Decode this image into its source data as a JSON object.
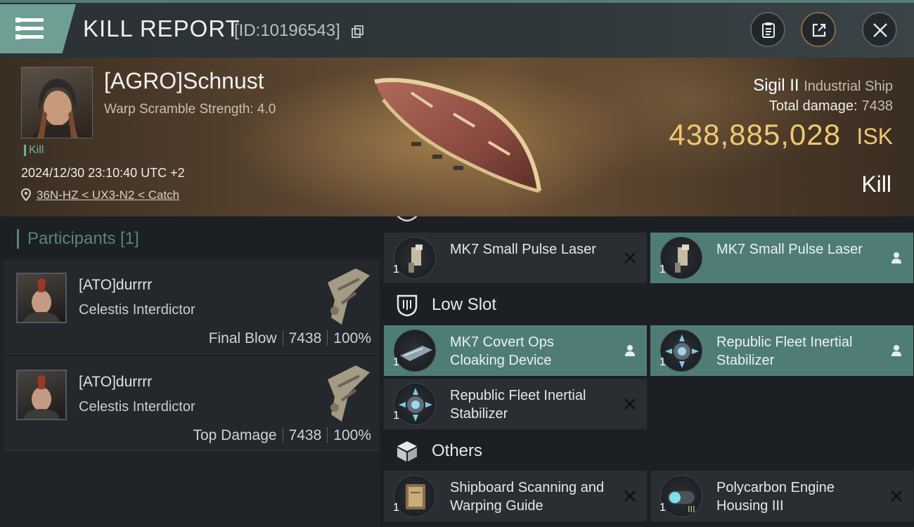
{
  "header": {
    "title": "KILL REPORT",
    "id_text": "[ID:10196543]",
    "buttons": {
      "clipboard": "clipboard-icon",
      "share": "share-icon",
      "close": "close-icon"
    }
  },
  "victim": {
    "pilot_name": "[AGRO]Schnust",
    "warp_scramble": "Warp Scramble Strength: 4.0",
    "kill_tag": "Kill",
    "datetime": "2024/12/30 23:10:40 UTC +2",
    "location": "36N-HZ < UX3-N2 < Catch",
    "ship_name": "Sigil II",
    "ship_class": "Industrial Ship",
    "total_damage_label": "Total damage:",
    "total_damage_value": "7438",
    "isk_value": "438,885,028",
    "isk_label": "ISK",
    "result": "Kill"
  },
  "participants": {
    "title": "Participants [1]",
    "rows": [
      {
        "name": "[ATO]durrrr",
        "ship": "Celestis Interdictor",
        "tag": "Final Blow",
        "damage": "7438",
        "percent": "100%"
      },
      {
        "name": "[ATO]durrrr",
        "ship": "Celestis Interdictor",
        "tag": "Top Damage",
        "damage": "7438",
        "percent": "100%"
      }
    ]
  },
  "fitting": {
    "high_modules": [
      {
        "qty": "1",
        "name": "MK7 Small Pulse Laser",
        "state": "destroyed"
      },
      {
        "qty": "1",
        "name": "MK7 Small Pulse Laser",
        "state": "dropped"
      }
    ],
    "low_slot_label": "Low Slot",
    "low_modules": [
      {
        "qty": "1",
        "name": "MK7 Covert Ops Cloaking Device",
        "state": "dropped"
      },
      {
        "qty": "1",
        "name": "Republic Fleet Inertial Stabilizer",
        "state": "dropped"
      },
      {
        "qty": "1",
        "name": "Republic Fleet Inertial Stabilizer",
        "state": "destroyed"
      }
    ],
    "others_label": "Others",
    "other_modules": [
      {
        "qty": "1",
        "name": "Shipboard Scanning and Warping Guide",
        "state": "destroyed"
      },
      {
        "qty": "1",
        "name": "Polycarbon Engine Housing III",
        "state": "destroyed",
        "tier": "III"
      }
    ]
  },
  "colors": {
    "accent_teal": "#4f7d76",
    "isk_gold": "#f0c872",
    "panel": "#2a2e33"
  }
}
